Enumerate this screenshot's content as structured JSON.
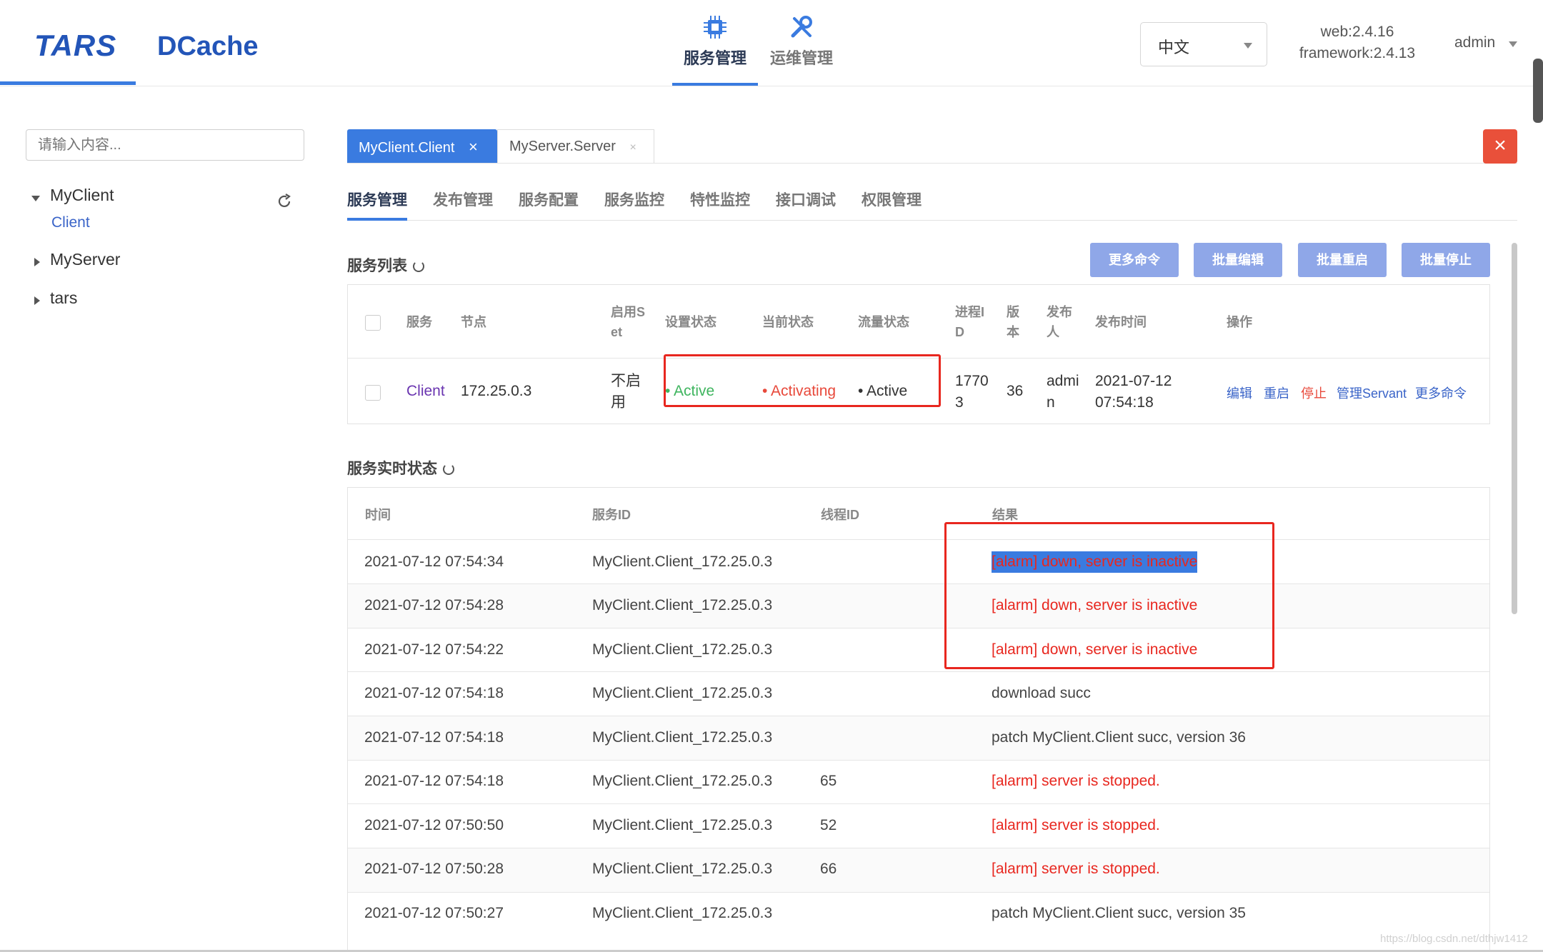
{
  "header": {
    "logo_tars": "TARS",
    "logo_dcache": "DCache",
    "nav": [
      {
        "label": "服务管理",
        "icon": "chip-icon",
        "active": true
      },
      {
        "label": "运维管理",
        "icon": "wrench-icon",
        "active": false
      }
    ],
    "language": "中文",
    "version_web": "web:2.4.16",
    "version_framework": "framework:2.4.13",
    "user": "admin"
  },
  "sidebar": {
    "search_placeholder": "请输入内容...",
    "tree": [
      {
        "label": "MyClient",
        "expanded": true,
        "children": [
          "Client"
        ]
      },
      {
        "label": "MyServer",
        "expanded": false
      },
      {
        "label": "tars",
        "expanded": false
      }
    ]
  },
  "service_tabs": [
    {
      "label": "MyClient.Client",
      "active": true
    },
    {
      "label": "MyServer.Server",
      "active": false
    }
  ],
  "sub_tabs": [
    "服务管理",
    "发布管理",
    "服务配置",
    "服务监控",
    "特性监控",
    "接口调试",
    "权限管理"
  ],
  "service_list": {
    "title": "服务列表",
    "buttons": [
      "更多命令",
      "批量编辑",
      "批量重启",
      "批量停止"
    ],
    "headers": {
      "service": "服务",
      "node": "节点",
      "enable_set": "启用S",
      "enable_set2": "et",
      "set_state": "设置状态",
      "current_state": "当前状态",
      "flow_state": "流量状态",
      "pid": "进程I",
      "pid2": "D",
      "version": "版",
      "version2": "本",
      "publisher": "发布",
      "publisher2": "人",
      "publish_time": "发布时间",
      "ops": "操作"
    },
    "rows": [
      {
        "service": "Client",
        "node": "172.25.0.3",
        "enable_set": "不启",
        "enable_set2": "用",
        "set_state": "• Active",
        "current_state": "• Activating",
        "flow_state": "• Active",
        "pid": "1770",
        "pid2": "3",
        "version": "36",
        "publisher": "admi",
        "publisher2": "n",
        "publish_date": "2021-07-12",
        "publish_clock": "07:54:18",
        "ops": [
          "编辑",
          "重启",
          "停止",
          "管理Servant",
          "更多命令"
        ]
      }
    ]
  },
  "realtime": {
    "title": "服务实时状态",
    "headers": {
      "time": "时间",
      "service_id": "服务ID",
      "thread_id": "线程ID",
      "result": "结果"
    },
    "rows": [
      {
        "time": "2021-07-12 07:54:34",
        "service_id": "MyClient.Client_172.25.0.3",
        "thread_id": "",
        "result": "[alarm] down, server is inactive",
        "alarm": true
      },
      {
        "time": "2021-07-12 07:54:28",
        "service_id": "MyClient.Client_172.25.0.3",
        "thread_id": "",
        "result": "[alarm] down, server is inactive",
        "alarm": true
      },
      {
        "time": "2021-07-12 07:54:22",
        "service_id": "MyClient.Client_172.25.0.3",
        "thread_id": "",
        "result": "[alarm] down, server is inactive",
        "alarm": true
      },
      {
        "time": "2021-07-12 07:54:18",
        "service_id": "MyClient.Client_172.25.0.3",
        "thread_id": "",
        "result": "download succ",
        "alarm": false
      },
      {
        "time": "2021-07-12 07:54:18",
        "service_id": "MyClient.Client_172.25.0.3",
        "thread_id": "",
        "result": "patch MyClient.Client succ, version 36",
        "alarm": false
      },
      {
        "time": "2021-07-12 07:54:18",
        "service_id": "MyClient.Client_172.25.0.3",
        "thread_id": "65",
        "result": "[alarm] server is stopped.",
        "alarm": true
      },
      {
        "time": "2021-07-12 07:50:50",
        "service_id": "MyClient.Client_172.25.0.3",
        "thread_id": "52",
        "result": "[alarm] server is stopped.",
        "alarm": true
      },
      {
        "time": "2021-07-12 07:50:28",
        "service_id": "MyClient.Client_172.25.0.3",
        "thread_id": "66",
        "result": "[alarm] server is stopped.",
        "alarm": true
      },
      {
        "time": "2021-07-12 07:50:27",
        "service_id": "MyClient.Client_172.25.0.3",
        "thread_id": "",
        "result": "patch MyClient.Client succ, version 35",
        "alarm": false
      }
    ]
  },
  "watermark": "https://blog.csdn.net/dthjw1412",
  "colors": {
    "accent": "#3a7be0",
    "alarm": "#e8271f",
    "active": "#3fb55f",
    "button": "#8fa7e8"
  }
}
